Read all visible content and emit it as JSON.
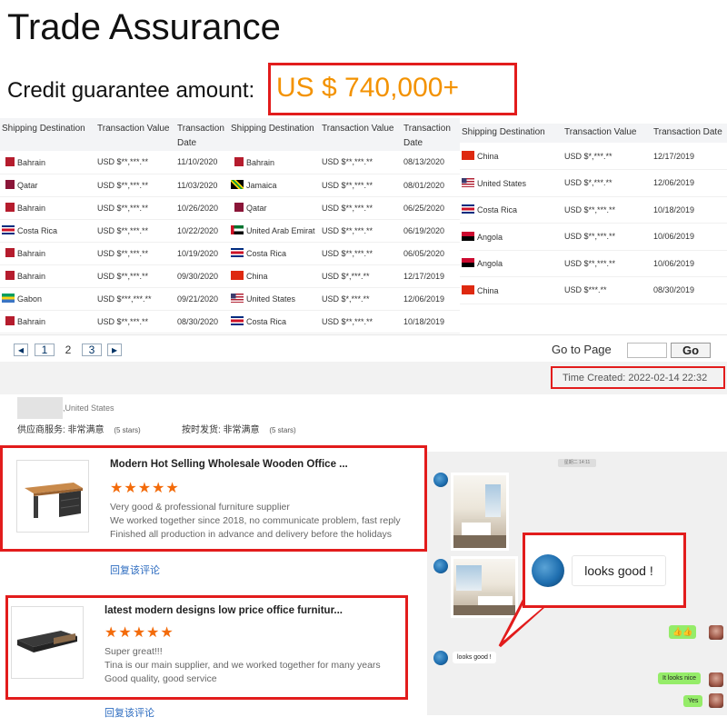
{
  "title": "Trade Assurance",
  "credit": {
    "label": "Credit guarantee amount:",
    "amount": "US $ 740,000+"
  },
  "tables": [
    {
      "headers": [
        "Shipping Destination",
        "Transaction Value",
        "Transaction Date"
      ],
      "rows": [
        {
          "country": "Bahrain",
          "flag": "bahrain",
          "value": "USD $**,***.**",
          "date": "11/10/2020"
        },
        {
          "country": "Qatar",
          "flag": "qatar",
          "value": "USD $**,***.**",
          "date": "11/03/2020"
        },
        {
          "country": "Bahrain",
          "flag": "bahrain",
          "value": "USD $**,***.**",
          "date": "10/26/2020"
        },
        {
          "country": "Costa Rica",
          "flag": "costa-rica",
          "value": "USD $**,***.**",
          "date": "10/22/2020"
        },
        {
          "country": "Bahrain",
          "flag": "bahrain",
          "value": "USD $**,***.**",
          "date": "10/19/2020"
        },
        {
          "country": "Bahrain",
          "flag": "bahrain",
          "value": "USD $**,***.**",
          "date": "09/30/2020"
        },
        {
          "country": "Gabon",
          "flag": "gabon",
          "value": "USD $***,***.**",
          "date": "09/21/2020"
        },
        {
          "country": "Bahrain",
          "flag": "bahrain",
          "value": "USD $**,***.**",
          "date": "08/30/2020"
        }
      ]
    },
    {
      "headers": [
        "Shipping Destination",
        "Transaction Value",
        "Transaction Date"
      ],
      "rows": [
        {
          "country": "Bahrain",
          "flag": "bahrain",
          "value": "USD $**,***.**",
          "date": "08/13/2020"
        },
        {
          "country": "Jamaica",
          "flag": "jamaica",
          "value": "USD $**,***.**",
          "date": "08/01/2020"
        },
        {
          "country": "Qatar",
          "flag": "qatar",
          "value": "USD $**,***.**",
          "date": "06/25/2020"
        },
        {
          "country": "United Arab Emirat",
          "flag": "uae",
          "value": "USD $**,***.**",
          "date": "06/19/2020"
        },
        {
          "country": "Costa Rica",
          "flag": "costa-rica",
          "value": "USD $**,***.**",
          "date": "06/05/2020"
        },
        {
          "country": "China",
          "flag": "china",
          "value": "USD $*,***.**",
          "date": "12/17/2019"
        },
        {
          "country": "United States",
          "flag": "usa",
          "value": "USD $*,***.**",
          "date": "12/06/2019"
        },
        {
          "country": "Costa Rica",
          "flag": "costa-rica",
          "value": "USD $**,***.**",
          "date": "10/18/2019"
        }
      ]
    },
    {
      "headers": [
        "Shipping Destination",
        "Transaction Value",
        "Transaction Date"
      ],
      "rows": [
        {
          "country": "China",
          "flag": "china",
          "value": "USD $*,***.**",
          "date": "12/17/2019"
        },
        {
          "country": "United States",
          "flag": "usa",
          "value": "USD $*,***.**",
          "date": "12/06/2019"
        },
        {
          "country": "Costa Rica",
          "flag": "costa-rica",
          "value": "USD $**,***.**",
          "date": "10/18/2019"
        },
        {
          "country": "Angola",
          "flag": "angola",
          "value": "USD $**,***.**",
          "date": "10/06/2019"
        },
        {
          "country": "Angola",
          "flag": "angola",
          "value": "USD $**,***.**",
          "date": "10/06/2019"
        },
        {
          "country": "China",
          "flag": "china",
          "value": "USD $***.**",
          "date": "08/30/2019"
        }
      ]
    }
  ],
  "pager": {
    "prev": "◂",
    "next": "▸",
    "pages": [
      "1",
      "2",
      "3"
    ],
    "current": "2",
    "goto_label": "Go to Page",
    "go_button": "Go"
  },
  "time_created": "Time Created: 2022-02-14 22:32",
  "reviewer": {
    "location": ",United States",
    "rating1_label": "供应商服务: 非常满意",
    "rating1_stars": "(5 stars)",
    "rating2_label": "按时发货: 非常满意",
    "rating2_stars": "(5 stars)"
  },
  "reviews": [
    {
      "title": "Modern Hot Selling Wholesale Wooden Office ...",
      "stars": "★★★★★",
      "lines": [
        "Very good & professional furniture supplier",
        "We worked together since 2018, no communicate problem, fast reply",
        "Finished all production in advance and delivery before the holidays"
      ],
      "reply": "回复该评论"
    },
    {
      "title": "latest modern designs low price office furnitur...",
      "stars": "★★★★★",
      "lines": [
        "Super great!!!",
        "Tina is our main supplier, and we worked together for many years",
        "Good quality, good service"
      ],
      "reply": "回复该评论"
    }
  ],
  "chat": {
    "time": "星期二 14:11",
    "callout": "looks good !",
    "msg_in": "looks good !",
    "msg_emoji": "👍👍",
    "msg_out1": "It looks nice",
    "msg_out2": "Yes"
  },
  "colors": {
    "accent": "#f39200",
    "highlight": "#e21c1c",
    "star": "#f36b0a",
    "link": "#2d6cc0"
  }
}
